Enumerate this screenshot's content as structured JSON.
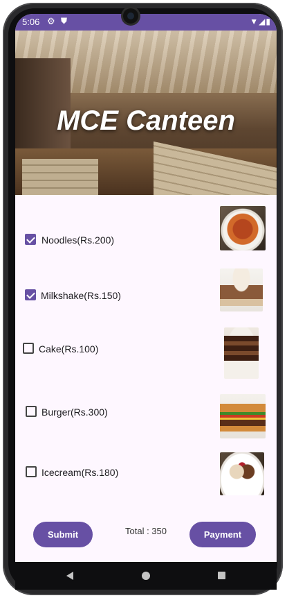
{
  "status_bar": {
    "time": "5:06",
    "left_icons": [
      "gear-icon",
      "shield-icon"
    ],
    "right_icons": [
      "wifi-icon",
      "signal-icon",
      "battery-icon"
    ]
  },
  "banner": {
    "title": "MCE Canteen"
  },
  "menu": {
    "items": [
      {
        "label": "Noodles(Rs.200)",
        "checked": true,
        "image_icon": "noodles-image"
      },
      {
        "label": "Milkshake(Rs.150)",
        "checked": true,
        "image_icon": "milkshake-image"
      },
      {
        "label": "Cake(Rs.100)",
        "checked": false,
        "image_icon": "cake-image"
      },
      {
        "label": "Burger(Rs.300)",
        "checked": false,
        "image_icon": "burger-image"
      },
      {
        "label": "Icecream(Rs.180)",
        "checked": false,
        "image_icon": "icecream-image"
      }
    ]
  },
  "footer": {
    "submit_label": "Submit",
    "total_text": "Total : 350",
    "payment_label": "Payment"
  },
  "nav": {
    "icons": [
      "back-icon",
      "home-icon",
      "recents-icon"
    ]
  },
  "colors": {
    "primary": "#6750a4",
    "background": "#fef7ff"
  }
}
